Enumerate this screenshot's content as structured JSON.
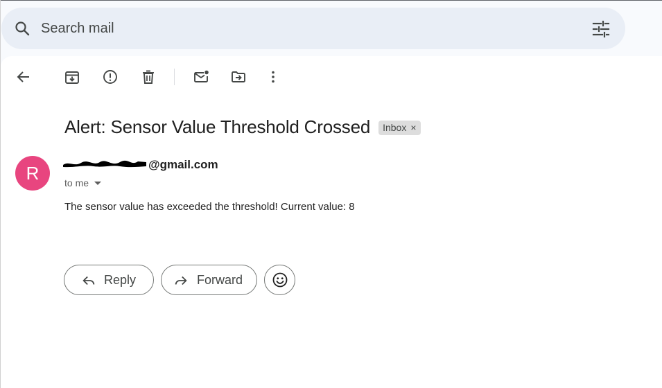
{
  "search": {
    "placeholder": "Search mail",
    "icon": "search-icon",
    "filter_icon": "tune-icon"
  },
  "toolbar": {
    "back": "arrow-left-icon",
    "archive": "archive-icon",
    "report_spam": "report-spam-icon",
    "delete": "trash-icon",
    "mark_unread": "mark-unread-icon",
    "move_to": "move-to-folder-icon",
    "more": "more-vert-icon"
  },
  "email": {
    "subject": "Alert: Sensor Value Threshold Crossed",
    "label_chip": "Inbox",
    "label_chip_close": "×",
    "avatar_letter": "R",
    "avatar_color": "#e8457f",
    "sender_visible_suffix": "@gmail.com",
    "recipient": "to me",
    "body": "The sensor value has exceeded the threshold! Current value: 8"
  },
  "actions": {
    "reply": "Reply",
    "forward": "Forward",
    "emoji": "smiley-icon"
  },
  "colors": {
    "page_bg": "#f8fafd",
    "search_bg": "#e9eef6",
    "panel_bg": "#ffffff",
    "chip_bg": "#dddddd",
    "icon_gray": "#444746"
  }
}
